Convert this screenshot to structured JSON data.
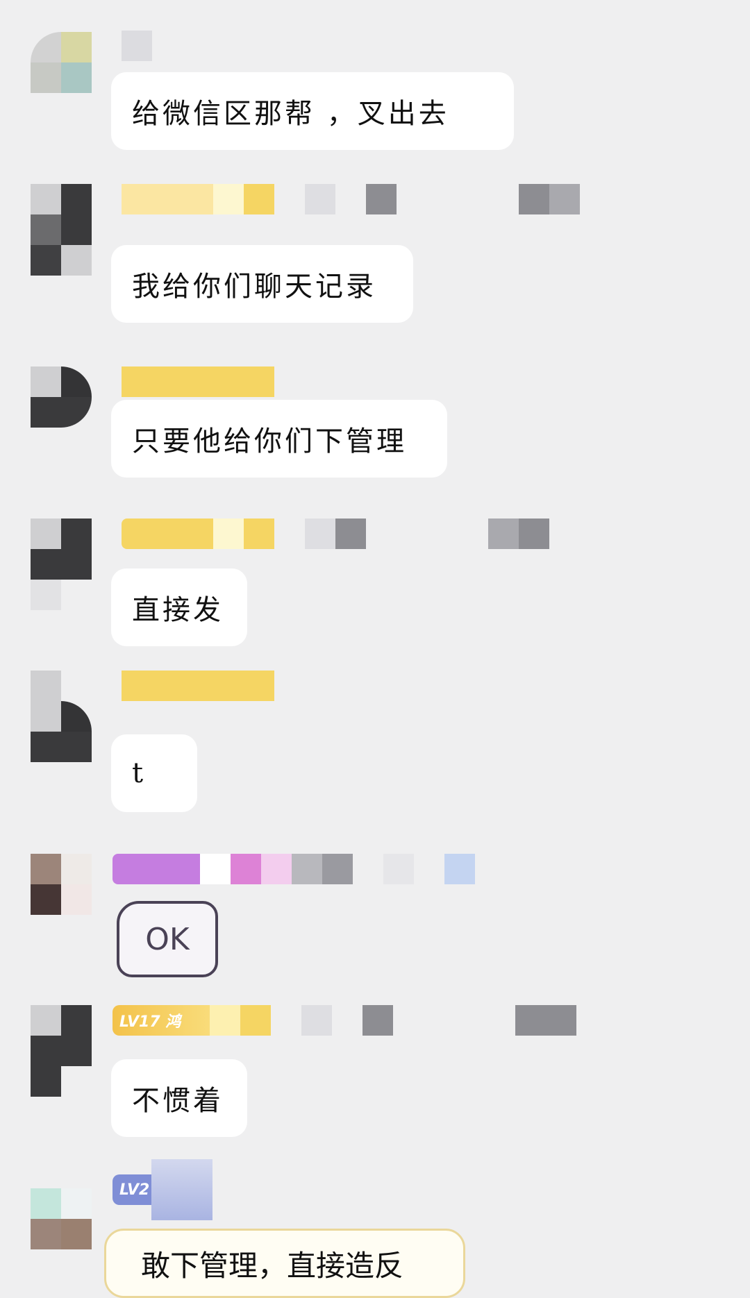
{
  "messages": [
    {
      "text": "给微信区那帮 ，叉出去"
    },
    {
      "text": "我给你们聊天记录"
    },
    {
      "text": "只要他给你们下管理"
    },
    {
      "text": "直接发"
    },
    {
      "text": "t"
    },
    {
      "text": "OK"
    },
    {
      "text": "不惯着",
      "level": "LV17 鸿"
    },
    {
      "text": "敢下管理，直接造反",
      "level": "LV2"
    }
  ],
  "colors": {
    "background": "#efeff0",
    "bubble": "#ffffff",
    "gold_bar": "#f5d563",
    "purple_bar": "#c57de0",
    "lv_gold": "#f3c24a",
    "lv_blue": "#7f8ed6"
  }
}
